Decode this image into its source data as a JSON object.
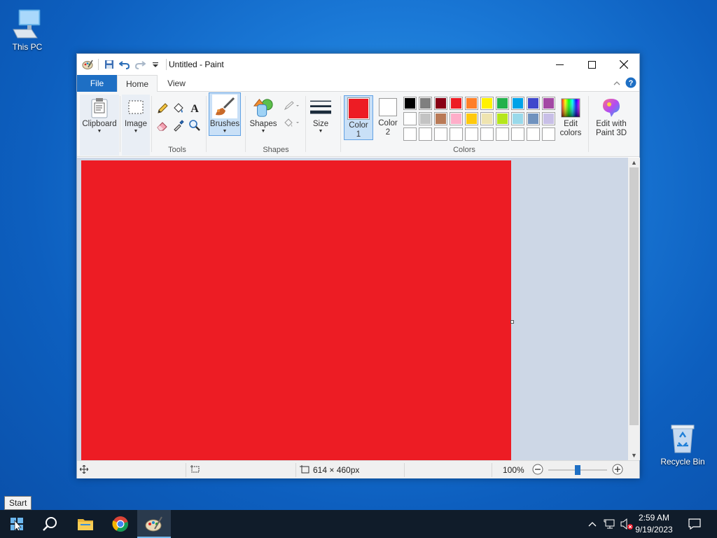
{
  "desktop": {
    "icons": [
      {
        "label": "This PC"
      },
      {
        "label": "Recycle Bin"
      }
    ]
  },
  "window": {
    "title": "Untitled - Paint",
    "tabs": [
      {
        "label": "File"
      },
      {
        "label": "Home"
      },
      {
        "label": "View"
      }
    ]
  },
  "ribbon": {
    "clipboard": {
      "label": "Clipboard"
    },
    "image": {
      "label": "Image"
    },
    "tools": {
      "group_label": "Tools"
    },
    "brushes": {
      "label": "Brushes"
    },
    "shapes": {
      "label": "Shapes",
      "group_label": "Shapes"
    },
    "size": {
      "label": "Size"
    },
    "color1": {
      "label_line1": "Color",
      "label_line2": "1",
      "value": "#ed1c24"
    },
    "color2": {
      "label_line1": "Color",
      "label_line2": "2",
      "value": "#ffffff"
    },
    "colors": {
      "group_label": "Colors"
    },
    "edit_colors": {
      "label_line1": "Edit",
      "label_line2": "colors"
    },
    "edit_paint3d": {
      "label_line1": "Edit with",
      "label_line2": "Paint 3D"
    },
    "palette": [
      [
        "#000000",
        "#7f7f7f",
        "#880015",
        "#ed1c24",
        "#ff7f27",
        "#fff200",
        "#22b14c",
        "#00a2e8",
        "#3f48cc",
        "#a349a4"
      ],
      [
        "#ffffff",
        "#c3c3c3",
        "#b97a57",
        "#ffaec9",
        "#ffc90e",
        "#efe4b0",
        "#b5e61d",
        "#99d9ea",
        "#7092be",
        "#c8bfe7"
      ],
      [
        "#ffffff",
        "#ffffff",
        "#ffffff",
        "#ffffff",
        "#ffffff",
        "#ffffff",
        "#ffffff",
        "#ffffff",
        "#ffffff",
        "#ffffff"
      ]
    ]
  },
  "canvas": {
    "fill_color": "#ed1c24"
  },
  "status": {
    "image_size": "614 × 460px",
    "zoom": "100%",
    "zoom_level": 0.5
  },
  "taskbar": {
    "time": "2:59 AM",
    "date": "9/19/2023",
    "tooltip": "Start"
  }
}
